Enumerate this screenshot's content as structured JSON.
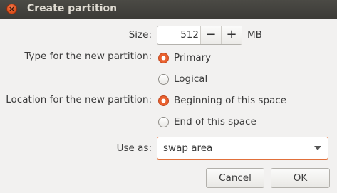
{
  "window": {
    "title": "Create partition",
    "close_icon": "×"
  },
  "size": {
    "label": "Size:",
    "value": "512",
    "minus": "−",
    "plus": "+",
    "unit": "MB"
  },
  "type": {
    "label": "Type for the new partition:",
    "options": [
      {
        "label": "Primary",
        "checked": true
      },
      {
        "label": "Logical",
        "checked": false
      }
    ]
  },
  "location": {
    "label": "Location for the new partition:",
    "options": [
      {
        "label": "Beginning of this space",
        "checked": true
      },
      {
        "label": "End of this space",
        "checked": false
      }
    ]
  },
  "use_as": {
    "label": "Use as:",
    "value": "swap area"
  },
  "buttons": {
    "cancel": "Cancel",
    "ok": "OK"
  },
  "colors": {
    "accent": "#e9612f",
    "titlebar": "#3c3b37"
  }
}
